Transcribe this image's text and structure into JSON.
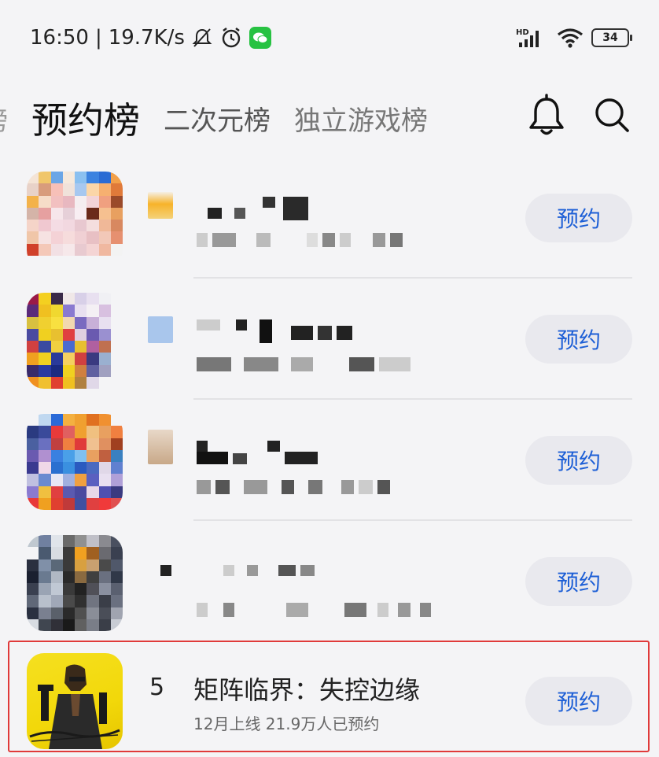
{
  "status_bar": {
    "time": "16:50",
    "separator": "|",
    "speed": "19.7K/s",
    "icons": [
      "mute-bell-icon",
      "alarm-icon",
      "wechat-icon",
      "hd-signal-icon",
      "wifi-icon"
    ],
    "hd_label": "HD",
    "battery": "34"
  },
  "tabs": {
    "partial_left": "榜",
    "active": "预约榜",
    "second": "二次元榜",
    "third": "独立游戏榜"
  },
  "list": {
    "button_label": "预约",
    "items": [
      {
        "rank": "",
        "title": "",
        "subtitle": ""
      },
      {
        "rank": "",
        "title": "",
        "subtitle": ""
      },
      {
        "rank": "",
        "title": "",
        "subtitle": ""
      },
      {
        "rank": "",
        "title": "",
        "subtitle": ""
      },
      {
        "rank": "5",
        "title": "矩阵临界：失控边缘",
        "subtitle": "12月上线  21.9万人已预约"
      }
    ]
  },
  "colors": {
    "accent": "#1d5fd6",
    "highlight": "#e03a3a",
    "background": "#f4f4f6"
  }
}
